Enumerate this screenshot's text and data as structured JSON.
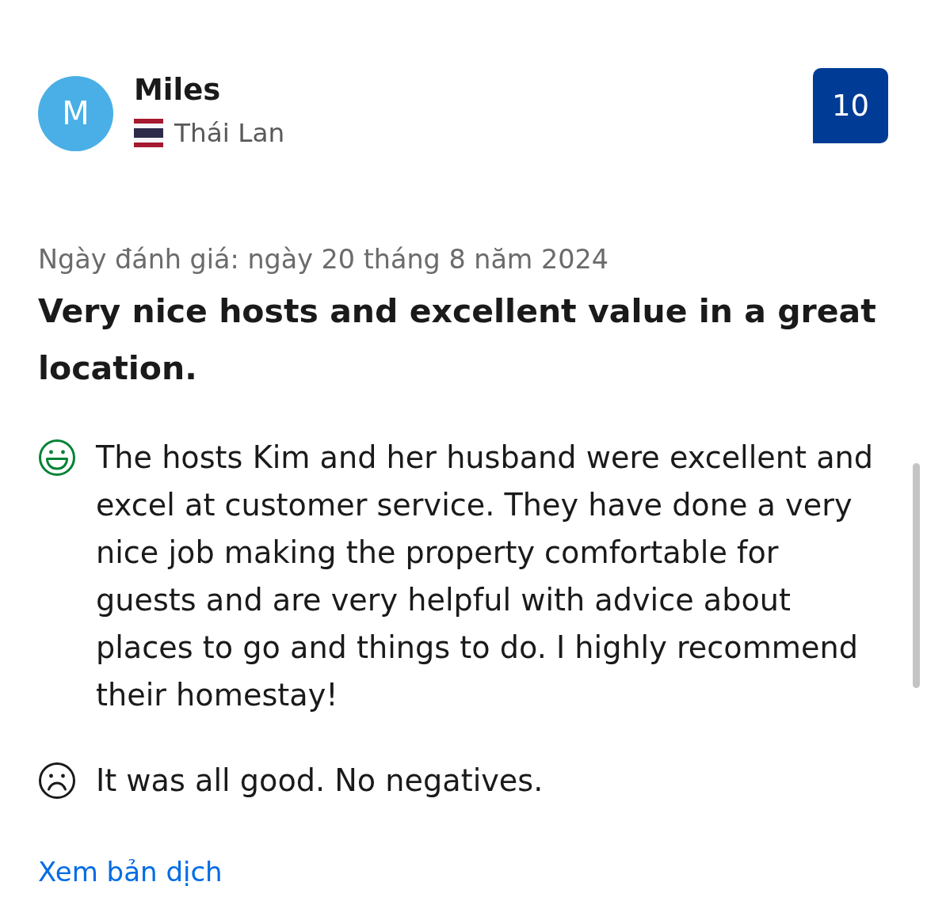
{
  "reviewer": {
    "avatar_letter": "M",
    "name": "Miles",
    "country": "Thái Lan"
  },
  "score": "10",
  "review_date": "Ngày đánh giá: ngày 20 tháng 8 năm 2024",
  "title": "Very nice hosts and excellent value in a great location.",
  "comments": [
    {
      "kind": "positive",
      "text": "The hosts Kim and her husband were excellent and excel at customer service. They have done a very nice job making the property comfortable for guests and are very helpful with advice about places to go and things to do. I highly recommend their homestay!"
    },
    {
      "kind": "negative",
      "text": "It was all good. No negatives."
    }
  ],
  "translate_link": "Xem bản dịch"
}
